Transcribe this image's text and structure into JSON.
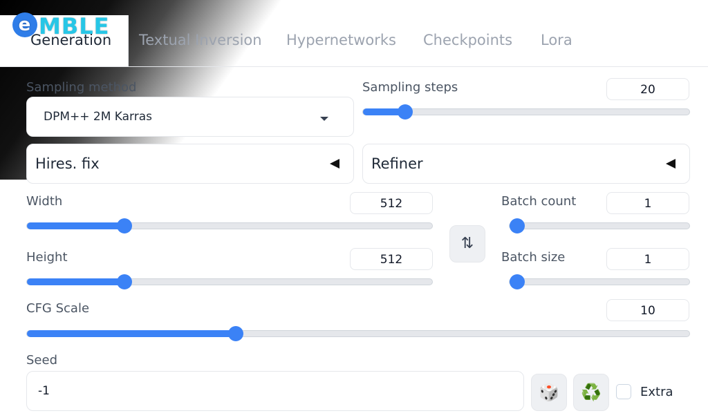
{
  "watermark": {
    "logo_text": "MBLE",
    "logo_mark": "e"
  },
  "tabs": [
    {
      "label": "Generation",
      "active": true
    },
    {
      "label": "Textual Inversion"
    },
    {
      "label": "Hypernetworks"
    },
    {
      "label": "Checkpoints"
    },
    {
      "label": "Lora"
    }
  ],
  "sampling_method": {
    "label": "Sampling method",
    "value": "DPM++ 2M Karras"
  },
  "sampling_steps": {
    "label": "Sampling steps",
    "value": "20",
    "fraction": 0.13
  },
  "hires_fix": {
    "label": "Hires. fix"
  },
  "refiner": {
    "label": "Refiner"
  },
  "width": {
    "label": "Width",
    "value": "512",
    "fraction": 0.24
  },
  "height": {
    "label": "Height",
    "value": "512",
    "fraction": 0.24
  },
  "swap_icon": "swap-vertical-icon",
  "swap_glyph": "⇅",
  "batch_count": {
    "label": "Batch count",
    "value": "1",
    "fraction": 0.0
  },
  "batch_size": {
    "label": "Batch size",
    "value": "1",
    "fraction": 0.0
  },
  "cfg_scale": {
    "label": "CFG Scale",
    "value": "10",
    "fraction": 0.315
  },
  "seed": {
    "label": "Seed",
    "value": "-1",
    "dice_glyph": "🎲",
    "recycle_glyph": "♻️"
  },
  "extra": {
    "label": "Extra",
    "checked": false
  },
  "colors": {
    "accent": "#3b82f6",
    "track": "#e5e7eb",
    "muted_tab": "#9ca3af"
  }
}
